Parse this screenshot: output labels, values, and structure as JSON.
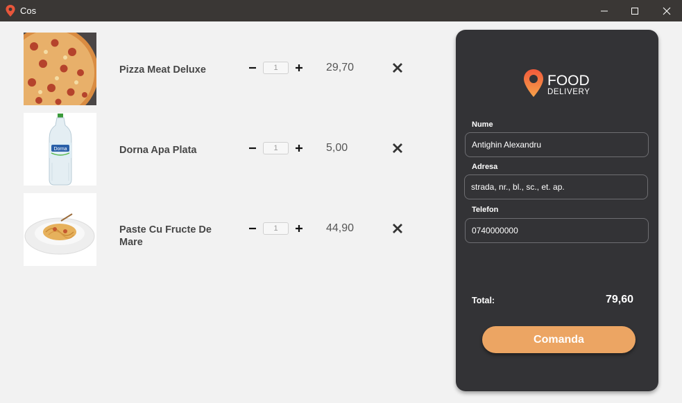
{
  "window": {
    "title": "Cos",
    "icon": "location-pin-icon",
    "controls": [
      "minimize-icon",
      "maximize-icon",
      "close-icon"
    ]
  },
  "cart": {
    "items": [
      {
        "name": "Pizza Meat Deluxe",
        "quantity": "1",
        "price": "29,70",
        "image": "pizza-image"
      },
      {
        "name": "Dorna Apa Plata",
        "quantity": "1",
        "price": "5,00",
        "image": "water-bottle-image"
      },
      {
        "name": "Paste Cu Fructe De Mare",
        "quantity": "1",
        "price": "44,90",
        "image": "pasta-image"
      }
    ]
  },
  "order_panel": {
    "logo": {
      "line1": "FOOD",
      "line2": "DELIVERY"
    },
    "fields": {
      "name_label": "Nume",
      "name_value": "Antighin Alexandru",
      "address_label": "Adresa",
      "address_value": "strada, nr., bl., sc., et. ap.",
      "phone_label": "Telefon",
      "phone_value": "0740000000"
    },
    "total_label": "Total:",
    "total_value": "79,60",
    "order_button": "Comanda"
  },
  "colors": {
    "panel_bg": "#333336",
    "accent": "#eca563",
    "pin_top": "#f15a3b",
    "pin_bottom": "#f7a24a",
    "titlebar": "#3a3735"
  }
}
